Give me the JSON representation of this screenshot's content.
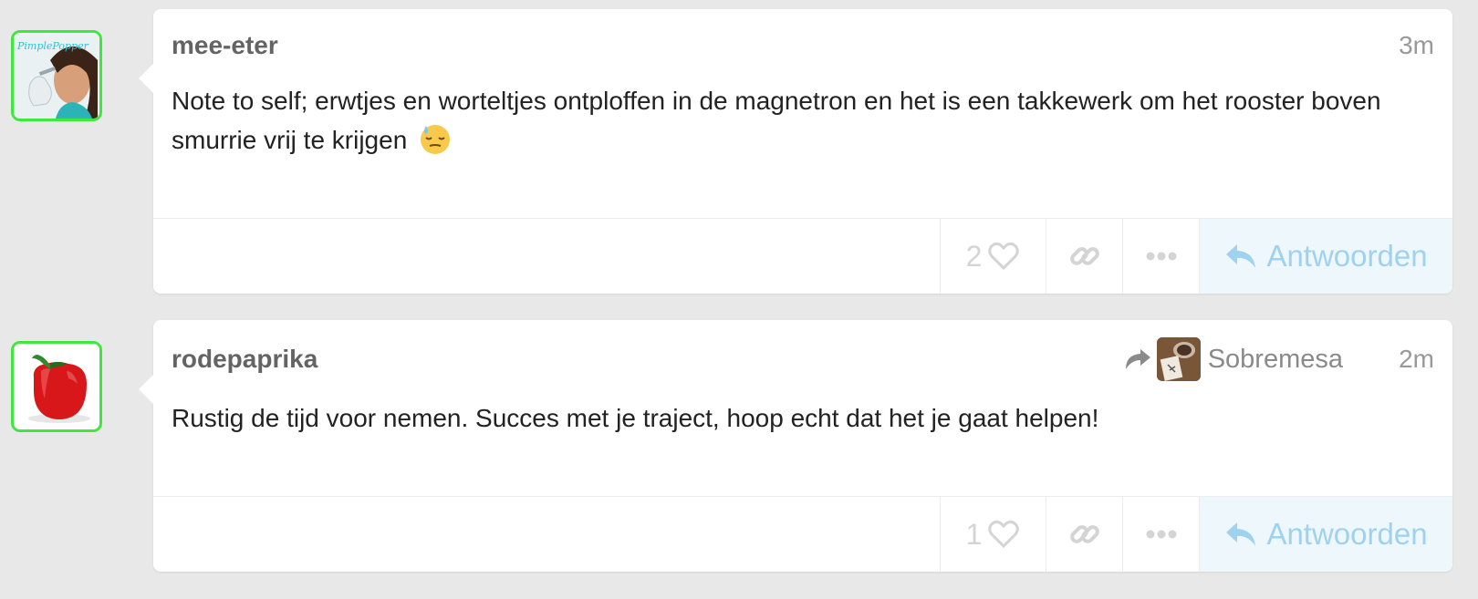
{
  "posts": [
    {
      "username": "mee-eter",
      "time": "3m",
      "text": "Note to self; erwtjes en worteltjes ontploffen in de magnetron en het is een takkewerk om het rooster boven smurrie vrij te krijgen",
      "emoji": "downcast-face-with-sweat",
      "avatar_icon": "pimplepopper-avatar",
      "avatar_text": "PimplePopper",
      "likes": "2",
      "reply_label": "Antwoorden"
    },
    {
      "username": "rodepaprika",
      "time": "2m",
      "reply_to": "Sobremesa",
      "text": "Rustig de tijd voor nemen. Succes met je traject, hoop echt dat het je gaat helpen!",
      "avatar_icon": "red-pepper-avatar",
      "likes": "1",
      "reply_label": "Antwoorden"
    }
  ],
  "colors": {
    "avatar_border": "#3fe83f",
    "reply_bg": "#eef7fc",
    "reply_text": "#9fd2ee",
    "action_icon": "#d4d4d4"
  }
}
